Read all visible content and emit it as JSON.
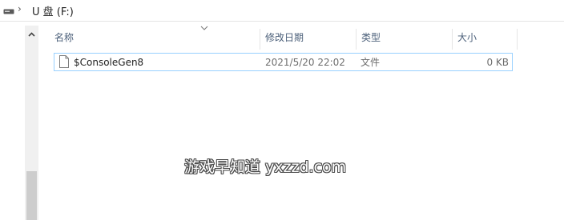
{
  "breadcrumb": {
    "drive_icon": "drive-icon",
    "separator": "›",
    "current_location": "U 盘 (F:)"
  },
  "columns": {
    "name": "名称",
    "date_modified": "修改日期",
    "type": "类型",
    "size": "大小",
    "sort_icon": "chevron-down-icon"
  },
  "files": [
    {
      "icon": "file-icon",
      "name": "$ConsoleGen8",
      "date_modified": "2021/5/20 22:02",
      "type": "文件",
      "size": "0 KB"
    }
  ],
  "watermark": "游戏早知道 yxzzd.com",
  "colors": {
    "selection_border": "#99d1ff",
    "header_text": "#4c607a"
  }
}
